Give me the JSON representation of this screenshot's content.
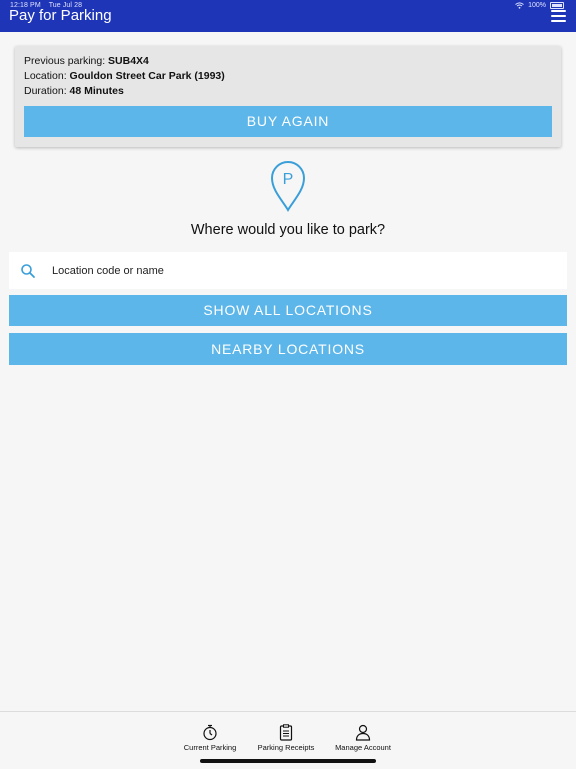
{
  "status_bar": {
    "time": "12:18 PM",
    "date": "Tue Jul 28",
    "battery": "100%"
  },
  "app": {
    "title": "Pay for Parking",
    "menu_icon": "hamburger-menu-icon"
  },
  "previous_parking": {
    "plate_label": "Previous parking: ",
    "plate_value": "SUB4X4",
    "location_label": "Location: ",
    "location_value": "Gouldon Street Car Park (1993)",
    "duration_label": "Duration: ",
    "duration_value": "48 Minutes",
    "buy_again_label": "BUY AGAIN"
  },
  "main": {
    "pin_icon": "parking-pin-icon",
    "pin_letter": "P",
    "question": "Where would you like to park?",
    "search_placeholder": "Location code or name",
    "search_value": "",
    "show_all_label": "SHOW ALL LOCATIONS",
    "nearby_label": "NEARBY LOCATIONS"
  },
  "tabs": [
    {
      "label": "Current Parking",
      "icon": "stopwatch-icon"
    },
    {
      "label": "Parking Receipts",
      "icon": "receipt-icon"
    },
    {
      "label": "Manage Account",
      "icon": "user-icon"
    }
  ],
  "colors": {
    "appbar": "#1f35b8",
    "button": "#5cb6ea",
    "card": "#e6e6e6",
    "background": "#f6f6f6"
  }
}
